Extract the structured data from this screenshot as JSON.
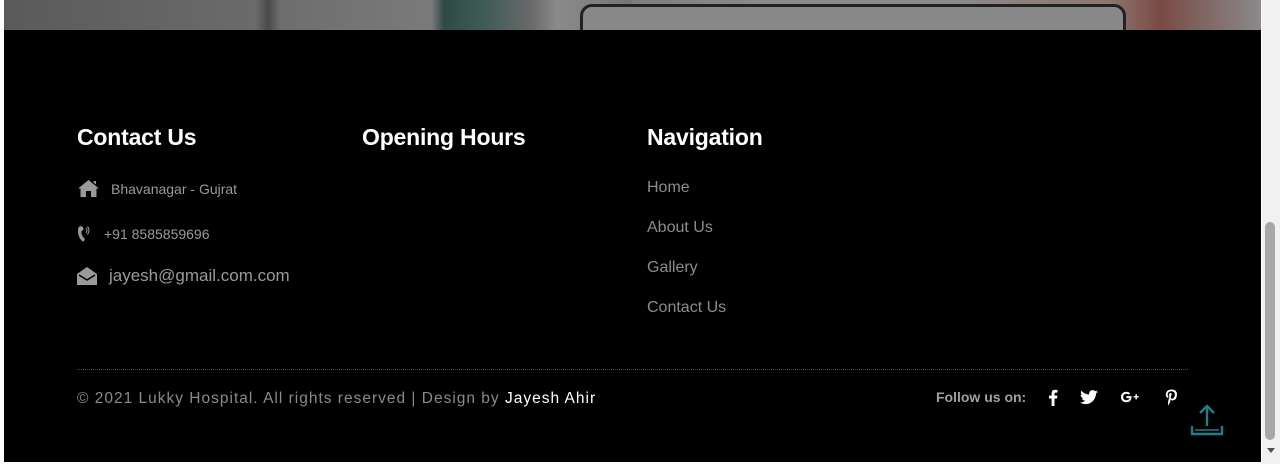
{
  "contact": {
    "heading": "Contact Us",
    "address": "Bhavanagar - Gujrat",
    "phone": "+91 8585859696",
    "email": "jayesh@gmail.com.com",
    "icons": [
      "home-icon",
      "phone-icon",
      "envelope-open-icon"
    ]
  },
  "hours": {
    "heading": "Opening Hours"
  },
  "navigation": {
    "heading": "Navigation",
    "items": [
      {
        "label": "Home"
      },
      {
        "label": "About Us"
      },
      {
        "label": "Gallery"
      },
      {
        "label": "Contact Us"
      }
    ]
  },
  "bottom_bar": {
    "copyright_prefix": "© 2021 Lukky Hospital. All rights reserved | Design by ",
    "author": "Jayesh Ahir",
    "follow_label": "Follow us on:",
    "social_icons": [
      "facebook-icon",
      "twitter-icon",
      "google-plus-icon",
      "pinterest-icon"
    ]
  },
  "colors": {
    "footer_background": "#000000",
    "heading_text": "#ffffff",
    "muted_text": "#8c8c8c",
    "back_to_top_accent": "#1f7d8c"
  }
}
